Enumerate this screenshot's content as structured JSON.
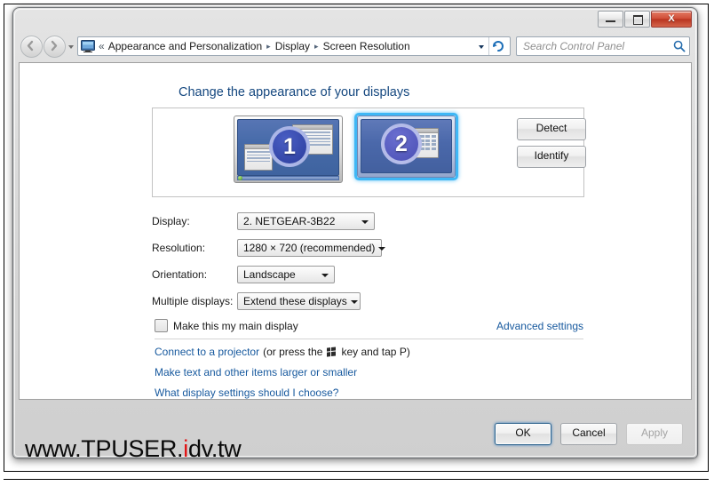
{
  "window": {
    "caption_buttons": {
      "minimize": "minimize-button",
      "maximize": "maximize-button",
      "close_glyph": "X"
    }
  },
  "navbar": {
    "back_label": "Back",
    "forward_label": "Forward",
    "recent_pages_label": "Recent pages",
    "address_icon": "monitor-icon",
    "crumb_overflow": "«",
    "breadcrumbs": [
      "Appearance and Personalization",
      "Display",
      "Screen Resolution"
    ],
    "separator": "▸",
    "refresh_label": "Refresh",
    "search": {
      "placeholder": "Search Control Panel"
    }
  },
  "content": {
    "heading": "Change the appearance of your displays",
    "preview": {
      "monitors": [
        {
          "number": "1",
          "selected": false
        },
        {
          "number": "2",
          "selected": true
        }
      ]
    },
    "side_buttons": {
      "detect": "Detect",
      "identify": "Identify"
    },
    "form": {
      "display": {
        "label": "Display:",
        "value": "2. NETGEAR-3B22"
      },
      "resolution": {
        "label": "Resolution:",
        "value": "1280 × 720 (recommended)"
      },
      "orientation": {
        "label": "Orientation:",
        "value": "Landscape"
      },
      "multiple_displays": {
        "label": "Multiple displays:",
        "value": "Extend these displays"
      }
    },
    "main_display_checkbox": {
      "label": "Make this my main display",
      "checked": false
    },
    "advanced_settings_link": "Advanced settings",
    "links": {
      "projector_link": "Connect to a projector",
      "projector_prefix": "(or press the",
      "projector_suffix": "key and tap P)",
      "windows_key_icon": "windows-logo-icon",
      "make_text_larger": "Make text and other items larger or smaller",
      "what_settings": "What display settings should I choose?"
    },
    "actions": {
      "ok": "OK",
      "cancel": "Cancel",
      "apply": "Apply",
      "apply_disabled": true
    }
  },
  "watermark": {
    "part1": "www.TPUSER.",
    "accent": "i",
    "part2": "dv.tw"
  },
  "colors": {
    "heading_blue": "#14477f",
    "link_blue": "#17599e",
    "selection_glow": "#3fb7f5",
    "close_red": "#b93520",
    "watermark_accent": "#e10f10"
  }
}
